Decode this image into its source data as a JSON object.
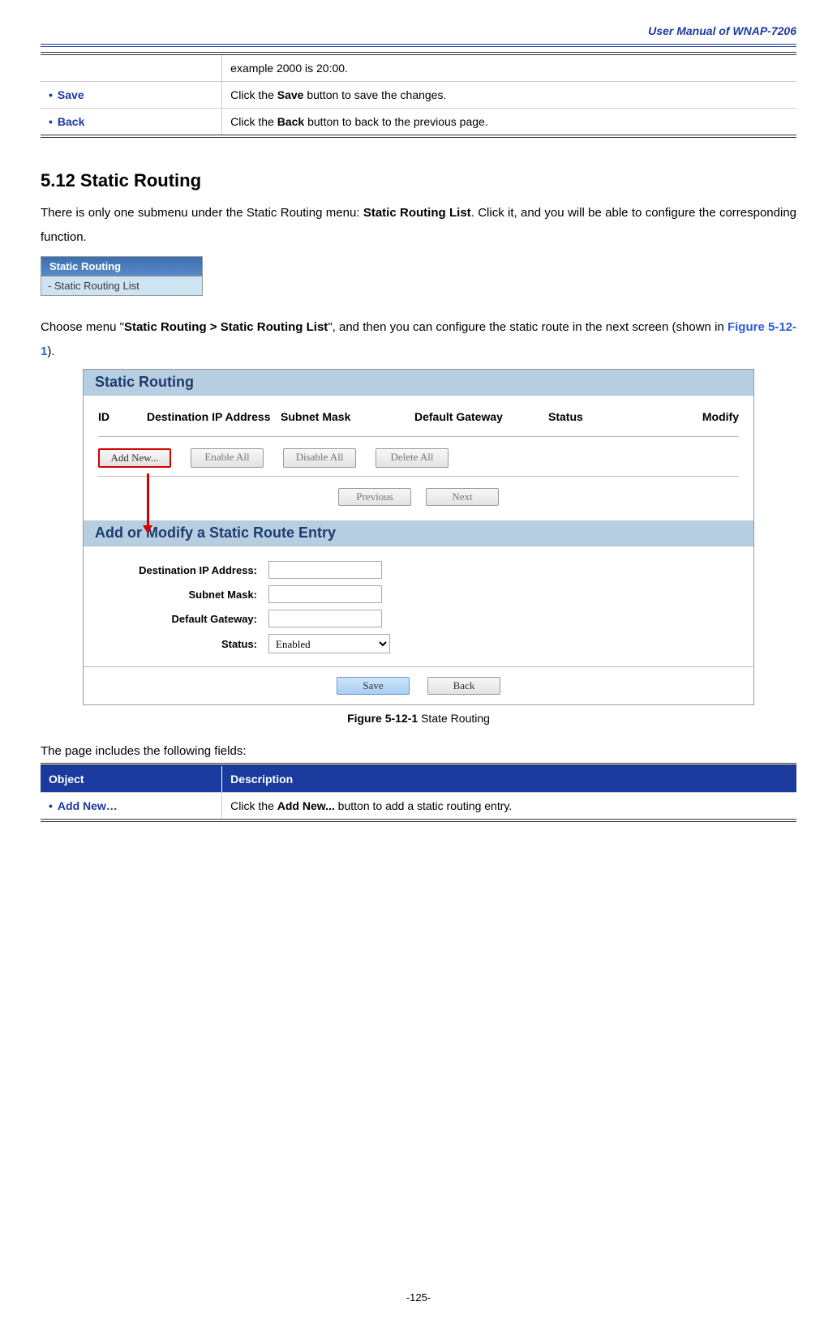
{
  "page_header": "User Manual of WNAP-7206",
  "top_table": {
    "row0": {
      "label": "",
      "desc": "example 2000 is 20:00."
    },
    "row1": {
      "label": "Save",
      "desc_prefix": "Click the ",
      "desc_bold": "Save",
      "desc_suffix": " button to save the changes."
    },
    "row2": {
      "label": "Back",
      "desc_prefix": "Click the ",
      "desc_bold": "Back",
      "desc_suffix": " button to back to the previous page."
    }
  },
  "section_title": "5.12  Static Routing",
  "para1_prefix": "There is only one submenu under the Static Routing menu: ",
  "para1_bold": "Static Routing List",
  "para1_suffix": ". Click it, and you will be able to configure the corresponding function.",
  "menu": {
    "head": "Static Routing",
    "item": "- Static Routing List"
  },
  "para2_prefix": "Choose menu \"",
  "para2_bold": "Static Routing > Static Routing List",
  "para2_mid": "\", and then you can configure the static route in the next screen (shown in ",
  "para2_ref": "Figure 5-12-1",
  "para2_suffix": ").",
  "figure": {
    "title": "Static Routing",
    "cols": {
      "id": "ID",
      "dest": "Destination IP Address",
      "mask": "Subnet Mask",
      "gw": "Default Gateway",
      "status": "Status",
      "modify": "Modify"
    },
    "buttons": {
      "add": "Add New...",
      "enable": "Enable All",
      "disable": "Disable All",
      "delete": "Delete All",
      "prev": "Previous",
      "next": "Next"
    },
    "sub_title": "Add or Modify a Static Route Entry",
    "labels": {
      "dest": "Destination IP Address:",
      "mask": "Subnet Mask:",
      "gw": "Default Gateway:",
      "status": "Status:"
    },
    "status_value": "Enabled",
    "save": "Save",
    "back": "Back"
  },
  "figure_caption_bold": "Figure 5-12-1",
  "figure_caption_rest": " State Routing",
  "fields_intro": "The page includes the following fields:",
  "bottom_table": {
    "h1": "Object",
    "h2": "Description",
    "r1_label": "Add New…",
    "r1_prefix": "Click the ",
    "r1_bold": "Add New...",
    "r1_suffix": " button to add a static routing entry."
  },
  "page_number": "-125-"
}
